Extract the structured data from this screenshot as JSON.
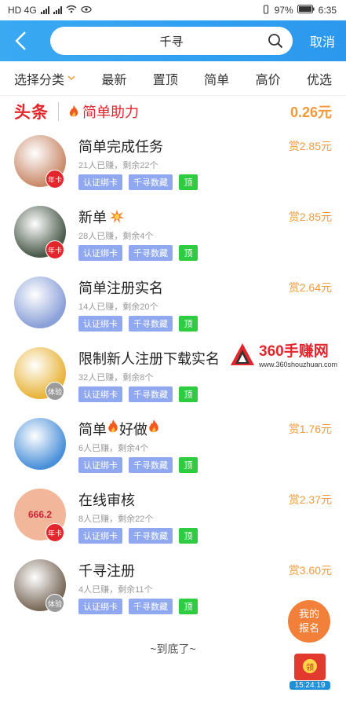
{
  "status": {
    "left": "HD 4G",
    "battery": "97%",
    "time": "6:35"
  },
  "topbar": {
    "search_query": "千寻",
    "cancel": "取消"
  },
  "filters": [
    "选择分类",
    "最新",
    "置顶",
    "简单",
    "高价",
    "优选"
  ],
  "headline": {
    "badge": "头条",
    "title": "简单助力",
    "price": "0.26元"
  },
  "tasks": [
    {
      "title": "简单完成任务",
      "reward": "赏2.85元",
      "meta": "21人已赚，剩余22个",
      "chips": [
        "认证绑卡",
        "千寻数藏",
        "顶"
      ],
      "tag": "年卡",
      "tag_color": "red",
      "suffix_icon": "",
      "avatar_color": "#c98a6a"
    },
    {
      "title": "新单",
      "reward": "赏2.85元",
      "meta": "28人已赚，剩余4个",
      "chips": [
        "认证绑卡",
        "千寻数藏",
        "顶"
      ],
      "tag": "年卡",
      "tag_color": "red",
      "suffix_icon": "explosion",
      "avatar_color": "#4a5a4a"
    },
    {
      "title": "简单注册实名",
      "reward": "赏2.64元",
      "meta": "14人已赚，剩余20个",
      "chips": [
        "认证绑卡",
        "千寻数藏",
        "顶"
      ],
      "tag": "",
      "tag_color": "",
      "suffix_icon": "",
      "avatar_color": "#8aa0d8"
    },
    {
      "title": "限制新人注册下载实名",
      "reward": "",
      "meta": "32人已赚，剩余8个",
      "chips": [
        "认证绑卡",
        "千寻数藏",
        "顶"
      ],
      "tag": "体验",
      "tag_color": "grey",
      "suffix_icon": "",
      "avatar_color": "#e8b43a"
    },
    {
      "title": "简单好做",
      "reward": "赏1.76元",
      "meta": "6人已赚，剩余4个",
      "chips": [
        "认证绑卡",
        "千寻数藏",
        "顶"
      ],
      "tag": "",
      "tag_color": "",
      "suffix_icon": "fire",
      "avatar_color": "#4a90d9"
    },
    {
      "title": "在线审核",
      "reward": "赏2.37元",
      "meta": "8人已赚，剩余22个",
      "chips": [
        "认证绑卡",
        "千寻数藏",
        "顶"
      ],
      "tag": "年卡",
      "tag_color": "red",
      "suffix_icon": "",
      "avatar_color": "#f2b79a",
      "avatar_text": "666.2"
    },
    {
      "title": "千寻注册",
      "reward": "赏3.60元",
      "meta": "4人已赚，剩余11个",
      "chips": [
        "认证绑卡",
        "千寻数藏",
        "顶"
      ],
      "tag": "体验",
      "tag_color": "grey",
      "suffix_icon": "",
      "avatar_color": "#7a6a5a"
    }
  ],
  "end_text": "~到底了~",
  "float_join": {
    "line1": "我的",
    "line2": "报名"
  },
  "float_red": {
    "coin": "领",
    "timer": "15:24:19"
  },
  "watermark": {
    "brand": "360手赚网",
    "url": "www.360shouzhuan.com"
  }
}
